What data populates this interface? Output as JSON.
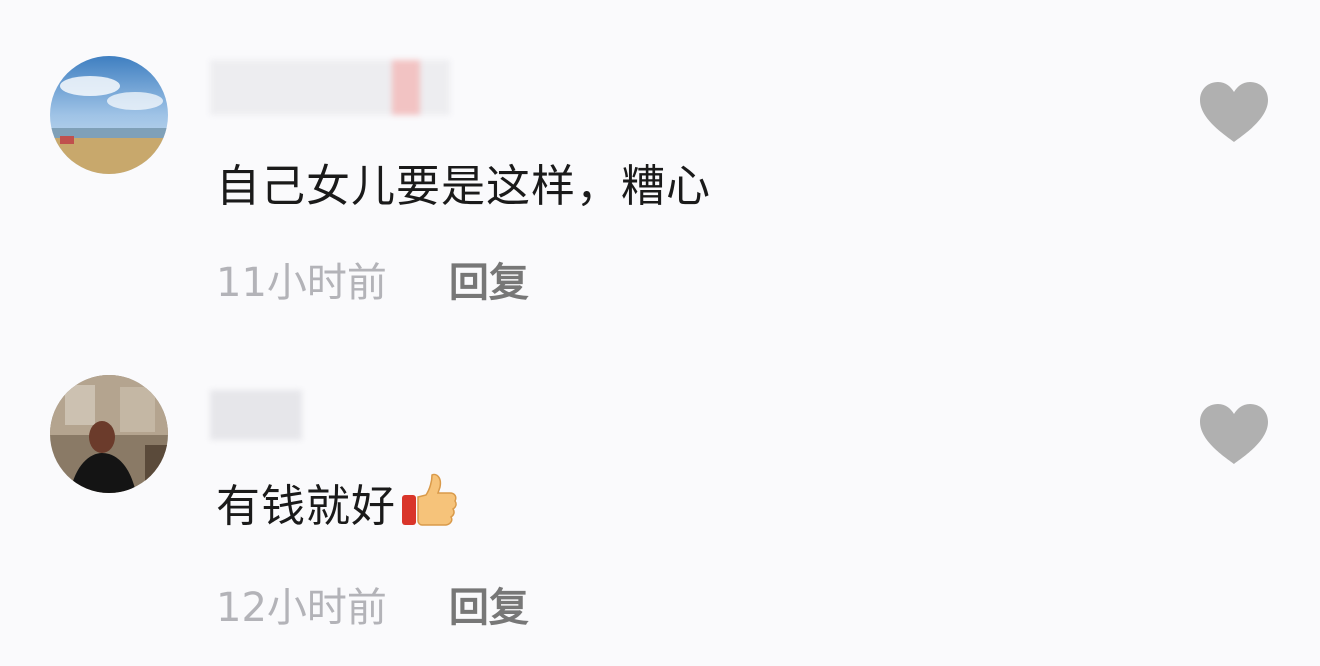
{
  "comments": [
    {
      "text": "自己女儿要是这样，糟心",
      "time": "11小时前",
      "reply_label": "回复"
    },
    {
      "text": "有钱就好",
      "emoji": "thumbs-up-icon",
      "time": "12小时前",
      "reply_label": "回复"
    }
  ],
  "colors": {
    "background": "#fafafc",
    "text": "#1a1a1a",
    "time": "#b3b3b8",
    "reply": "#777777",
    "like_icon": "#b0b0b0"
  }
}
